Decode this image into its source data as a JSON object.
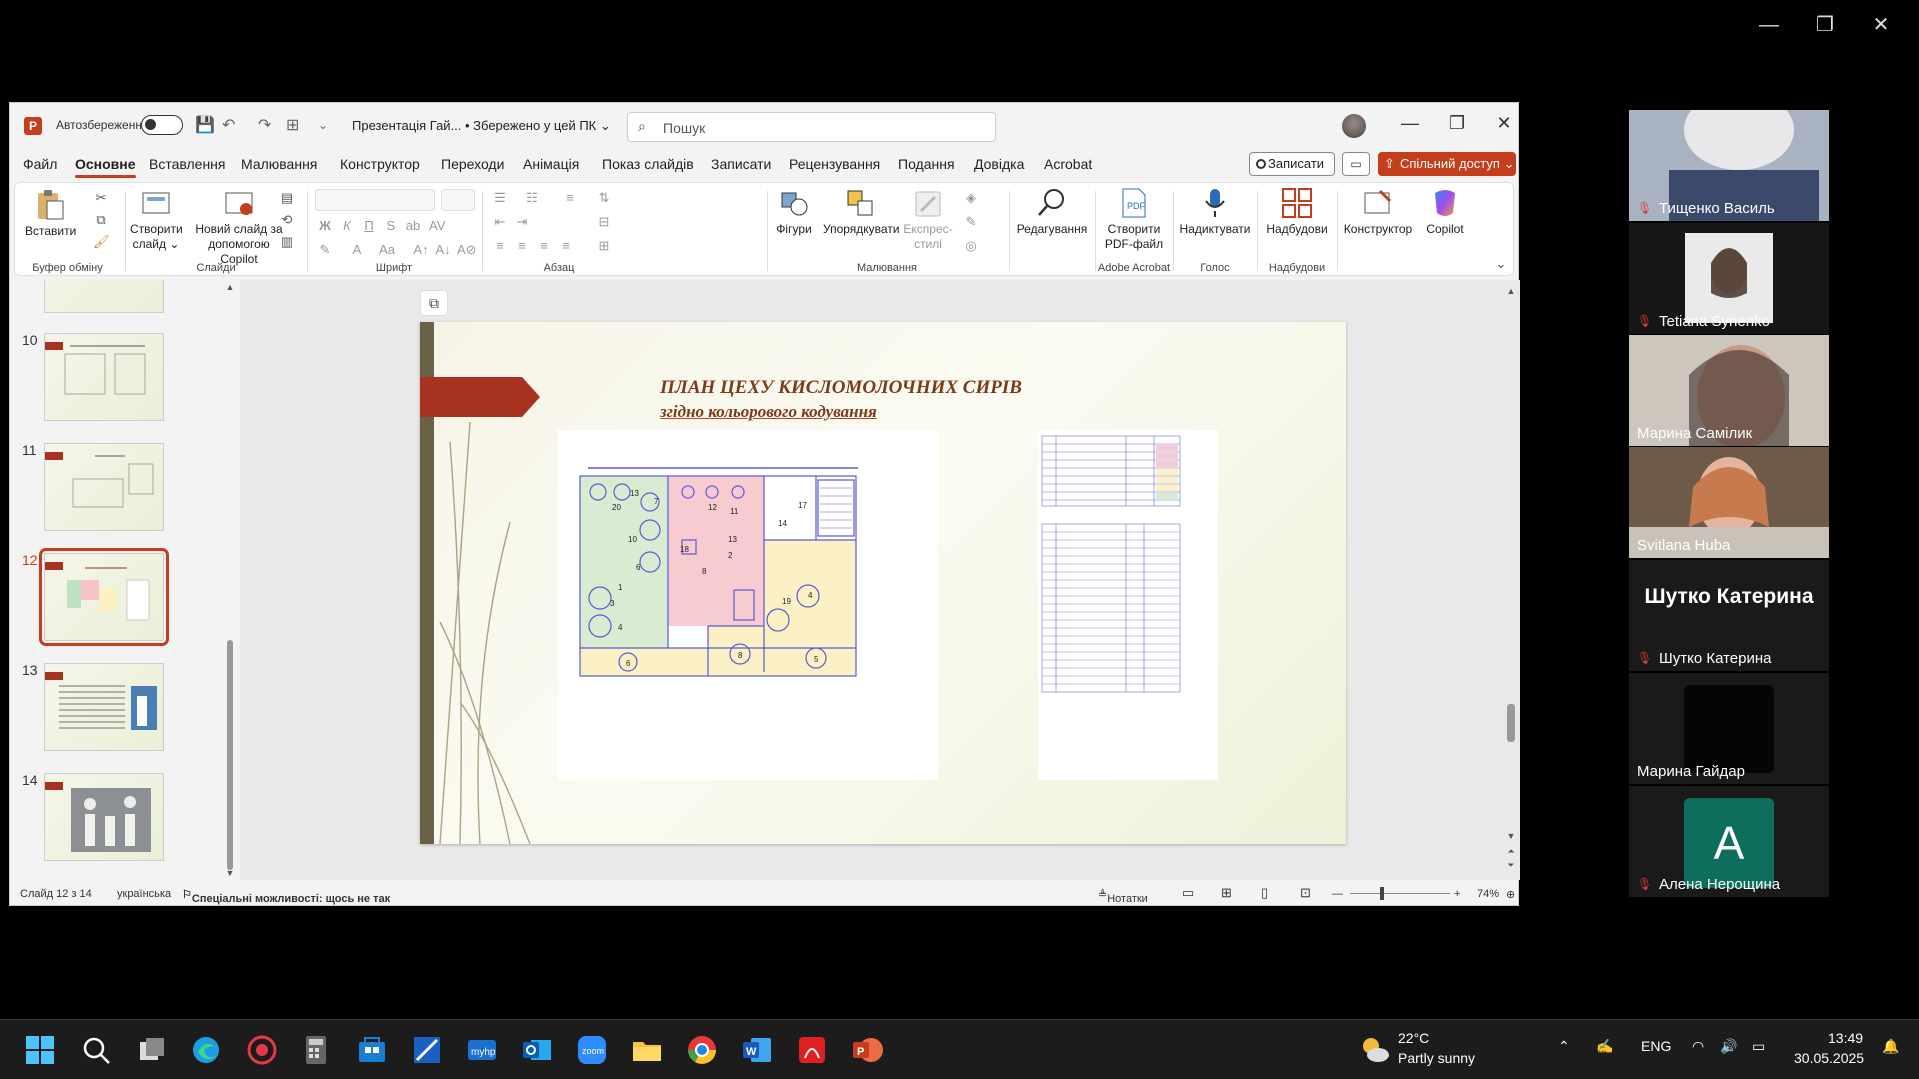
{
  "zoom_window": {
    "minimize": "—",
    "restore": "❐",
    "close": "✕"
  },
  "titlebar": {
    "app_logo": "P",
    "autosave_label": "Автозбереження",
    "filename": "Презентація Гай... • Збережено у цей ПК ⌄",
    "search_placeholder": "Пошук",
    "minimize": "—",
    "restore": "❐",
    "close": "✕"
  },
  "tabs": [
    "Файл",
    "Основне",
    "Вставлення",
    "Малювання",
    "Конструктор",
    "Переходи",
    "Анімація",
    "Показ слайдів",
    "Записати",
    "Рецензування",
    "Подання",
    "Довідка",
    "Acrobat"
  ],
  "active_tab": "Основне",
  "header_buttons": {
    "record": "Записати",
    "share": "Спільний доступ"
  },
  "ribbon": {
    "paste": "Вставити",
    "clipboard_group": "Буфер обміну",
    "new_slide": "Створити слайд ⌄",
    "new_slide_copilot": "Новий слайд за допомогою Copilot",
    "slides_group": "Слайди",
    "font_group": "Шрифт",
    "paragraph_group": "Абзац",
    "shapes": "Фігури",
    "arrange": "Упорядкувати",
    "express_styles": "Експрес-стилі",
    "drawing_group": "Малювання",
    "editing": "Редагування",
    "create_pdf": "Створити PDF-файл",
    "acrobat_group": "Adobe Acrobat",
    "dictate": "Надиктувати",
    "voice_group": "Голос",
    "addins": "Надбудови",
    "addins_group": "Надбудови",
    "designer": "Конструктор",
    "copilot": "Copilot"
  },
  "thumbnails": [
    {
      "num": "10"
    },
    {
      "num": "11"
    },
    {
      "num": "12"
    },
    {
      "num": "13"
    },
    {
      "num": "14"
    }
  ],
  "slide": {
    "title": "ПЛАН ЦЕХУ КИСЛОМОЛОЧНИХ СИРІВ",
    "subtitle": "згідно кольорового кодування"
  },
  "statusbar": {
    "slide_info": "Слайд 12 з 14",
    "language": "українська",
    "accessibility": "Спеціальні можливості: щось не так",
    "notes": "Нотатки",
    "zoom": "74%"
  },
  "participants": [
    {
      "name": "Тищенко Василь",
      "muted": true
    },
    {
      "name": "Tetiana Synenko",
      "muted": true
    },
    {
      "name": "Марина Самілик",
      "muted": false,
      "active": true
    },
    {
      "name": "Svitlana Huba",
      "muted": false
    },
    {
      "name": "Шутко Катерина",
      "muted": true,
      "bigname": "Шутко Катерина"
    },
    {
      "name": "Марина Гайдар",
      "muted": false
    },
    {
      "name": "Алена Нерощина",
      "muted": true,
      "avatar_letter": "A"
    }
  ],
  "tray": {
    "temperature": "22°C",
    "weather": "Partly sunny",
    "lang": "ENG",
    "time": "13:49",
    "date": "30.05.2025"
  }
}
